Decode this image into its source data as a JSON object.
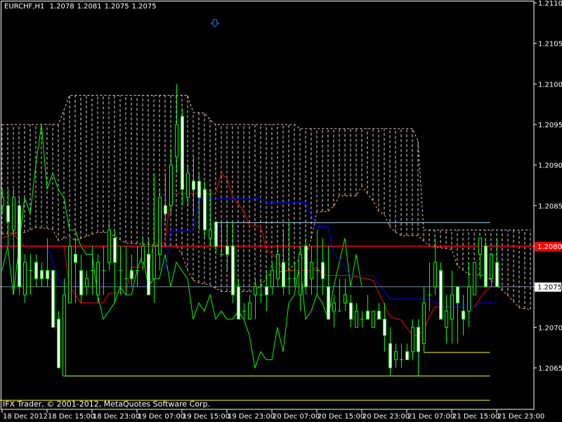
{
  "header": {
    "symbol": "EURCHF,H1",
    "ohlc": [
      "1.2078",
      "1.2081",
      "1.2075",
      "1.2075"
    ]
  },
  "footer": {
    "copyright": "IFX Trader, © 2001-2012, MetaQuotes Software Corp."
  },
  "colors": {
    "background": "#000000",
    "axis": "#ffffff",
    "candle_outline": "#00ff00",
    "bear_fill": "#ffffff",
    "bull_fill": "#000000",
    "tenkan": "#ff0000",
    "kijun": "#0000ff",
    "chikou": "#00ff00",
    "senkou_a": "#f4a460",
    "senkou_b": "#e6c8d8",
    "cloud_hatch": "#e0d0d8",
    "level_red": "#ff0000",
    "bid_line": "#778899",
    "level_lightblue": "#add8e6",
    "level_yellow": "#ffff00",
    "arrow": "#4169e1"
  },
  "chart_data": {
    "type": "candlestick",
    "title": "EURCHF,H1",
    "ylim": [
      1.20599,
      1.21105
    ],
    "yticks": [
      "1.2110",
      "1.2105",
      "1.2100",
      "1.2095",
      "1.2090",
      "1.2085",
      "1.2080",
      "1.2075",
      "1.2070",
      "1.2065"
    ],
    "xticks": [
      {
        "bar": 0,
        "label": "18 Dec 2012"
      },
      {
        "bar": 8,
        "label": "18 Dec 15:00"
      },
      {
        "bar": 16,
        "label": "18 Dec 23:00"
      },
      {
        "bar": 24,
        "label": "19 Dec 07:00"
      },
      {
        "bar": 32,
        "label": "19 Dec 15:00"
      },
      {
        "bar": 40,
        "label": "19 Dec 23:00"
      },
      {
        "bar": 48,
        "label": "20 Dec 07:00"
      },
      {
        "bar": 56,
        "label": "20 Dec 15:00"
      },
      {
        "bar": 64,
        "label": "20 Dec 23:00"
      },
      {
        "bar": 72,
        "label": "21 Dec 07:00"
      },
      {
        "bar": 80,
        "label": "21 Dec 15:00"
      },
      {
        "bar": 88,
        "label": "21 Dec 23:00"
      }
    ],
    "candles_ohlc": [
      [
        1.2085,
        1.2087,
        1.2084,
        1.2086
      ],
      [
        1.2085,
        1.2087,
        1.208,
        1.2083
      ],
      [
        1.2082,
        1.2087,
        1.2074,
        1.2086
      ],
      [
        1.2085,
        1.2086,
        1.2074,
        1.2075
      ],
      [
        1.2074,
        1.2079,
        1.2073,
        1.2078
      ],
      [
        1.2077,
        1.2079,
        1.2074,
        1.2077
      ],
      [
        1.2078,
        1.2079,
        1.2075,
        1.2076
      ],
      [
        1.2077,
        1.2078,
        1.2075,
        1.2076
      ],
      [
        1.2077,
        1.2081,
        1.2075,
        1.2076
      ],
      [
        1.2077,
        1.2077,
        1.207,
        1.207
      ],
      [
        1.2071,
        1.2072,
        1.2065,
        1.2065
      ],
      [
        1.2064,
        1.2076,
        1.2064,
        1.2074
      ],
      [
        1.2073,
        1.2081,
        1.2073,
        1.208
      ],
      [
        1.2079,
        1.2081,
        1.2073,
        1.2078
      ],
      [
        1.2077,
        1.2079,
        1.2073,
        1.2074
      ],
      [
        1.2075,
        1.2077,
        1.2074,
        1.2076
      ],
      [
        1.2077,
        1.208,
        1.2074,
        1.2077
      ],
      [
        1.2074,
        1.2079,
        1.2073,
        1.2078
      ],
      [
        1.2077,
        1.208,
        1.2074,
        1.2077
      ],
      [
        1.2078,
        1.2083,
        1.2077,
        1.2082
      ],
      [
        1.2081,
        1.2082,
        1.2073,
        1.2078
      ],
      [
        1.2077,
        1.208,
        1.2074,
        1.2077
      ],
      [
        1.2076,
        1.208,
        1.2074,
        1.2076
      ],
      [
        1.2077,
        1.2079,
        1.2075,
        1.2076
      ],
      [
        1.2077,
        1.208,
        1.2075,
        1.2077
      ],
      [
        1.2078,
        1.2081,
        1.2077,
        1.208
      ],
      [
        1.2079,
        1.2081,
        1.2074,
        1.2074
      ],
      [
        1.2076,
        1.2089,
        1.2073,
        1.208
      ],
      [
        1.2079,
        1.2087,
        1.2077,
        1.2086
      ],
      [
        1.2085,
        1.2089,
        1.2083,
        1.2084
      ],
      [
        1.2085,
        1.2092,
        1.2084,
        1.209
      ],
      [
        1.2091,
        1.21,
        1.2089,
        1.2095
      ],
      [
        1.2096,
        1.2097,
        1.2085,
        1.2087
      ],
      [
        1.2086,
        1.209,
        1.2085,
        1.2089
      ],
      [
        1.2088,
        1.2091,
        1.2084,
        1.2087
      ],
      [
        1.2088,
        1.2089,
        1.2082,
        1.2086
      ],
      [
        1.2087,
        1.2088,
        1.2081,
        1.2082
      ],
      [
        1.2081,
        1.2087,
        1.208,
        1.2082
      ],
      [
        1.2083,
        1.2083,
        1.2079,
        1.208
      ],
      [
        1.2079,
        1.2083,
        1.2079,
        1.2079
      ],
      [
        1.208,
        1.2083,
        1.2077,
        1.2079
      ],
      [
        1.208,
        1.2083,
        1.2073,
        1.2074
      ],
      [
        1.2075,
        1.2076,
        1.2071,
        1.2071
      ],
      [
        1.2072,
        1.2073,
        1.2071,
        1.2072
      ],
      [
        1.2071,
        1.2074,
        1.2071,
        1.2073
      ],
      [
        1.2074,
        1.2076,
        1.2071,
        1.2075
      ],
      [
        1.2074,
        1.2076,
        1.2073,
        1.2074
      ],
      [
        1.2075,
        1.2077,
        1.2072,
        1.2074
      ],
      [
        1.2075,
        1.2078,
        1.2074,
        1.2077
      ],
      [
        1.2076,
        1.208,
        1.2075,
        1.2079
      ],
      [
        1.2078,
        1.2082,
        1.2074,
        1.2075
      ],
      [
        1.2076,
        1.2083,
        1.2074,
        1.2076
      ],
      [
        1.2076,
        1.2078,
        1.2075,
        1.2076
      ],
      [
        1.2074,
        1.208,
        1.2072,
        1.2079
      ],
      [
        1.208,
        1.2081,
        1.2074,
        1.2075
      ],
      [
        1.2076,
        1.208,
        1.2074,
        1.2078
      ],
      [
        1.2077,
        1.2082,
        1.2074,
        1.2077
      ],
      [
        1.2078,
        1.2081,
        1.2074,
        1.2076
      ],
      [
        1.2075,
        1.208,
        1.2071,
        1.2071
      ],
      [
        1.2072,
        1.2074,
        1.207,
        1.2073
      ],
      [
        1.2072,
        1.2076,
        1.2072,
        1.2072
      ],
      [
        1.2073,
        1.2076,
        1.2072,
        1.2074
      ],
      [
        1.2073,
        1.2074,
        1.207,
        1.2071
      ],
      [
        1.207,
        1.2073,
        1.207,
        1.2072
      ],
      [
        1.2071,
        1.2072,
        1.207,
        1.2071
      ],
      [
        1.2072,
        1.2074,
        1.2071,
        1.2071
      ],
      [
        1.207,
        1.2072,
        1.207,
        1.2072
      ],
      [
        1.2072,
        1.2073,
        1.2071,
        1.2071
      ],
      [
        1.2071,
        1.2073,
        1.2067,
        1.2069
      ],
      [
        1.2068,
        1.207,
        1.2064,
        1.2065
      ],
      [
        1.2066,
        1.2068,
        1.2065,
        1.2067
      ],
      [
        1.2066,
        1.2068,
        1.2065,
        1.2066
      ],
      [
        1.2067,
        1.2068,
        1.2066,
        1.2066
      ],
      [
        1.2067,
        1.2071,
        1.2066,
        1.207
      ],
      [
        1.207,
        1.2071,
        1.2064,
        1.2067
      ],
      [
        1.2068,
        1.2075,
        1.2067,
        1.2073
      ],
      [
        1.2074,
        1.2078,
        1.2072,
        1.2074
      ],
      [
        1.2075,
        1.2081,
        1.2074,
        1.2078
      ],
      [
        1.2077,
        1.2078,
        1.2071,
        1.2071
      ],
      [
        1.207,
        1.2074,
        1.2068,
        1.2072
      ],
      [
        1.2071,
        1.2077,
        1.2068,
        1.2074
      ],
      [
        1.2075,
        1.2075,
        1.2068,
        1.2073
      ],
      [
        1.2072,
        1.2074,
        1.2069,
        1.2071
      ],
      [
        1.2072,
        1.2078,
        1.207,
        1.2075
      ],
      [
        1.2074,
        1.2078,
        1.2074,
        1.2078
      ],
      [
        1.2079,
        1.2081,
        1.2076,
        1.2081
      ],
      [
        1.208,
        1.2081,
        1.2075,
        1.2075
      ],
      [
        1.2076,
        1.2079,
        1.2075,
        1.2079
      ],
      [
        1.2078,
        1.2081,
        1.2075,
        1.2075
      ]
    ],
    "ichimoku": {
      "chikou_shift": 24,
      "tenkan": [
        [
          0,
          1.2081
        ],
        [
          2,
          1.20815
        ],
        [
          4,
          1.208
        ],
        [
          11,
          1.208
        ],
        [
          12,
          1.2075
        ],
        [
          14,
          1.2073
        ],
        [
          18,
          1.2073
        ],
        [
          19,
          1.20742
        ],
        [
          22,
          1.20742
        ],
        [
          23,
          1.20774
        ],
        [
          26,
          1.20774
        ],
        [
          27,
          1.20804
        ],
        [
          29,
          1.20804
        ],
        [
          30,
          1.20865
        ],
        [
          38,
          1.20865
        ],
        [
          39,
          1.20889
        ],
        [
          40,
          1.20884
        ],
        [
          41,
          1.20861
        ],
        [
          43,
          1.20843
        ],
        [
          44,
          1.20825
        ],
        [
          46,
          1.20825
        ],
        [
          47,
          1.20796
        ],
        [
          49,
          1.20785
        ],
        [
          50,
          1.2077
        ],
        [
          55,
          1.2077
        ],
        [
          56,
          1.20774
        ],
        [
          57,
          1.20765
        ],
        [
          58,
          1.20764
        ],
        [
          62,
          1.20764
        ],
        [
          66,
          1.20758
        ],
        [
          69,
          1.20713
        ],
        [
          71,
          1.20709
        ],
        [
          73,
          1.2069
        ],
        [
          74,
          1.2069
        ],
        [
          75,
          1.20696
        ],
        [
          76,
          1.20713
        ],
        [
          77,
          1.20725
        ],
        [
          84,
          1.20725
        ],
        [
          86,
          1.20745
        ],
        [
          87,
          1.2075
        ],
        [
          88,
          1.2075
        ]
      ],
      "kijun": [
        [
          0,
          1.20804
        ],
        [
          2,
          1.208
        ],
        [
          8,
          1.208
        ],
        [
          10,
          1.20759
        ],
        [
          11,
          1.20754
        ],
        [
          25,
          1.20754
        ],
        [
          26,
          1.2075
        ],
        [
          27,
          1.20764
        ],
        [
          29,
          1.20764
        ],
        [
          30,
          1.20819
        ],
        [
          34,
          1.20819
        ],
        [
          35,
          1.20859
        ],
        [
          46,
          1.20859
        ],
        [
          47,
          1.20854
        ],
        [
          54,
          1.20854
        ],
        [
          56,
          1.20824
        ],
        [
          58,
          1.20824
        ],
        [
          59,
          1.2079
        ],
        [
          60,
          1.20783
        ],
        [
          62,
          1.20764
        ],
        [
          66,
          1.20764
        ],
        [
          69,
          1.20735
        ],
        [
          76,
          1.20735
        ],
        [
          77,
          1.2073
        ],
        [
          80,
          1.20725
        ],
        [
          84,
          1.20725
        ],
        [
          85,
          1.2073
        ],
        [
          88,
          1.2073
        ]
      ],
      "senkou_a": [
        [
          0,
          1.20815
        ],
        [
          4,
          1.20817
        ],
        [
          6,
          1.20823
        ],
        [
          9,
          1.20821
        ],
        [
          10,
          1.20807
        ],
        [
          12,
          1.20812
        ],
        [
          13,
          1.20807
        ],
        [
          17,
          1.20817
        ],
        [
          19,
          1.20817
        ],
        [
          20,
          1.20812
        ],
        [
          22,
          1.20804
        ],
        [
          26,
          1.20802
        ],
        [
          31,
          1.208
        ],
        [
          32,
          1.2079
        ],
        [
          33,
          1.2077
        ],
        [
          34,
          1.20758
        ],
        [
          35,
          1.20755
        ],
        [
          37,
          1.20752
        ],
        [
          38,
          1.20748
        ],
        [
          39,
          1.20744
        ],
        [
          44,
          1.20744
        ],
        [
          45,
          1.20746
        ],
        [
          46,
          1.2075
        ],
        [
          47,
          1.20761
        ],
        [
          48,
          1.20767
        ],
        [
          51,
          1.2077
        ],
        [
          52,
          1.20778
        ],
        [
          53,
          1.20784
        ],
        [
          54,
          1.20787
        ],
        [
          55,
          1.20809
        ],
        [
          56,
          1.20842
        ],
        [
          58,
          1.20843
        ],
        [
          59,
          1.20849
        ],
        [
          60,
          1.20862
        ],
        [
          63,
          1.20862
        ],
        [
          64,
          1.20874
        ],
        [
          65,
          1.20865
        ],
        [
          66,
          1.20856
        ],
        [
          67,
          1.20843
        ],
        [
          68,
          1.20839
        ],
        [
          69,
          1.20824
        ],
        [
          70,
          1.20817
        ],
        [
          71,
          1.20813
        ],
        [
          74,
          1.20813
        ],
        [
          76,
          1.208
        ],
        [
          80,
          1.20796
        ],
        [
          81,
          1.20776
        ],
        [
          83,
          1.20765
        ],
        [
          86,
          1.20764
        ],
        [
          88,
          1.20752
        ],
        [
          90,
          1.20739
        ],
        [
          92,
          1.20724
        ],
        [
          94,
          1.20722
        ]
      ],
      "senkou_b": [
        [
          0,
          1.2095
        ],
        [
          10,
          1.2095
        ],
        [
          12,
          1.20986
        ],
        [
          33,
          1.20986
        ],
        [
          34,
          1.20965
        ],
        [
          36,
          1.20964
        ],
        [
          37,
          1.20956
        ],
        [
          38,
          1.2095
        ],
        [
          52,
          1.2095
        ],
        [
          53,
          1.20945
        ],
        [
          73,
          1.20945
        ],
        [
          74,
          1.2093
        ],
        [
          75,
          1.2082
        ],
        [
          94,
          1.2082
        ]
      ]
    },
    "levels": [
      {
        "name": "red-level",
        "price": 1.208,
        "from_bar": -1,
        "to_bar": 95,
        "label": "1.2080"
      },
      {
        "name": "bid-line",
        "price": 1.2075,
        "from_bar": -1,
        "to_bar": 95,
        "label": "1.2075"
      },
      {
        "name": "lightblue-level",
        "price": 1.20829,
        "from_bar": 38,
        "to_bar": 86.8
      },
      {
        "name": "yellow-level-low",
        "price": 1.2064,
        "from_bar": 11,
        "to_bar": 86.8
      },
      {
        "name": "yellow-level-mid",
        "price": 1.20669,
        "from_bar": 75,
        "to_bar": 86.8
      },
      {
        "name": "yellow-level-bottom",
        "price": 1.2061,
        "from_bar": -1,
        "to_bar": 86.8
      }
    ],
    "arrow": {
      "bar": 37.8,
      "price": 1.21075,
      "direction": "down"
    }
  }
}
